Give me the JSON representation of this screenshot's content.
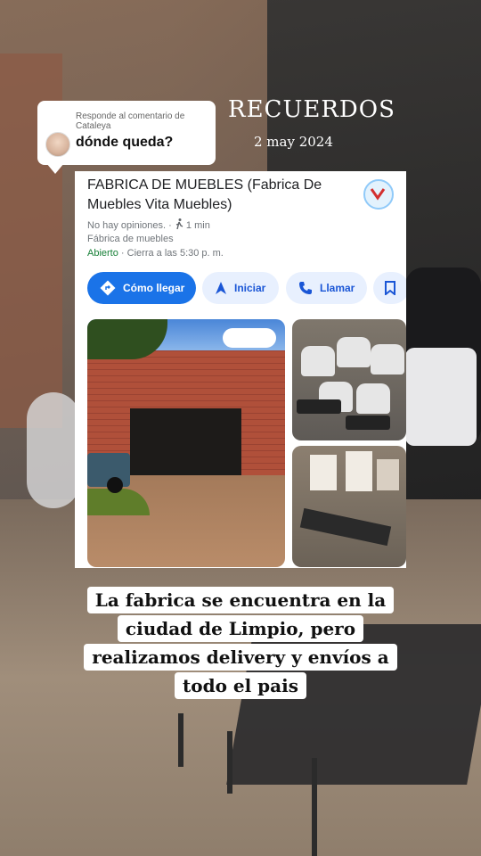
{
  "reply_bubble": {
    "label": "Responde al comentario de Cataleya",
    "comment": "dónde queda?"
  },
  "overlay": {
    "title": "RECUERDOS",
    "date": "2 may 2024"
  },
  "place_card": {
    "name": "FABRICA DE MUEBLES (Fabrica De Muebles Vita Muebles)",
    "reviews": "No hay opiniones.",
    "walk_time": "1 min",
    "category": "Fábrica de muebles",
    "status": "Abierto",
    "hours": "Cierra a las 5:30 p. m.",
    "buttons": {
      "directions": "Cómo llegar",
      "start": "Iniciar",
      "call": "Llamar"
    },
    "colors": {
      "primary": "#1a73e8",
      "open": "#188038"
    }
  },
  "caption": {
    "line1": "La fabrica se encuentra en la",
    "line2": "ciudad de Limpio, pero",
    "line3": "realizamos delivery y envíos a",
    "line4": "todo el pais"
  }
}
